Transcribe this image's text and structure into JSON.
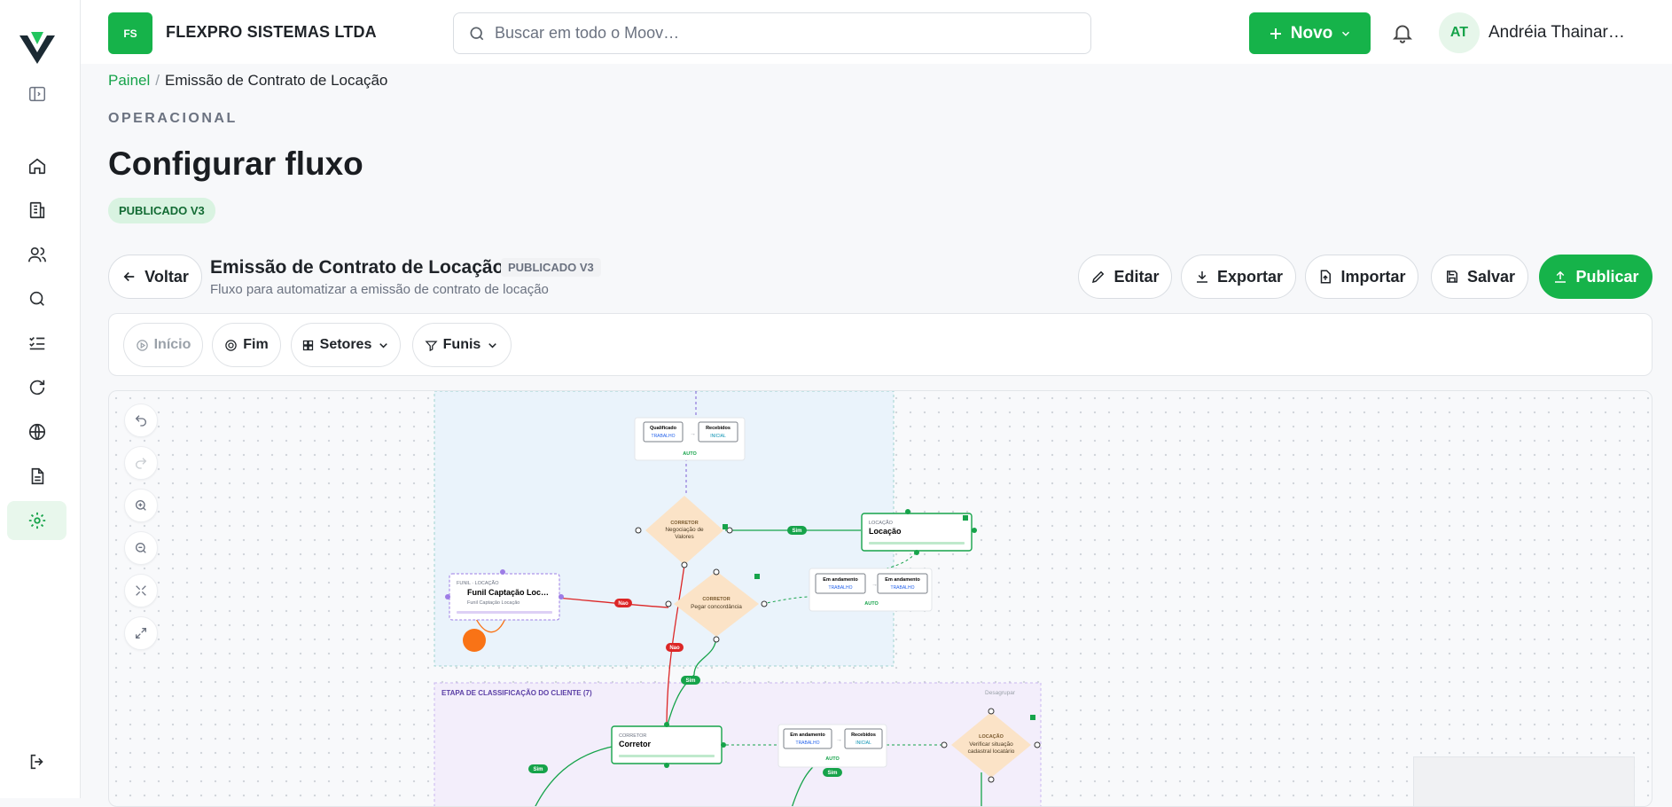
{
  "org": {
    "initials": "FS",
    "name": "FLEXPRO SISTEMAS LTDA"
  },
  "search": {
    "placeholder": "Buscar em todo o Moov…"
  },
  "header": {
    "new_label": "Novo",
    "user_initials": "AT",
    "user_name": "Andréia Thainar…"
  },
  "breadcrumb": {
    "root": "Painel",
    "current": "Emissão de Contrato de Locação"
  },
  "page": {
    "eyebrow": "OPERACIONAL",
    "title": "Configurar fluxo",
    "status": "PUBLICADO V3"
  },
  "flow": {
    "back_label": "Voltar",
    "name": "Emissão de Contrato de Locação",
    "badge": "PUBLICADO V3",
    "description": "Fluxo para automatizar a emissão de contrato de locação",
    "actions": {
      "edit": "Editar",
      "export": "Exportar",
      "import": "Importar",
      "save": "Salvar",
      "publish": "Publicar"
    }
  },
  "filters": {
    "inicio": "Início",
    "fim": "Fim",
    "setores": "Setores",
    "funis": "Funis"
  },
  "diagram": {
    "nodes": {
      "transition_top_from": "Qualificado",
      "transition_top_from_tag": "TRABALHO",
      "transition_top_to": "Recebidos",
      "transition_top_to_tag": "INICIAL",
      "auto": "AUTO",
      "decision1_role": "CORRETOR",
      "decision1_line1": "Negociação de",
      "decision1_line2": "Valores",
      "yes": "Sim",
      "no": "Nao",
      "locacao_role": "LOCAÇÃO",
      "locacao_title": "Locação",
      "transition_mid_from": "Em andamento",
      "transition_mid_from_tag": "TRABALHO",
      "transition_mid_to": "Em andamento",
      "transition_mid_to_tag": "TRABALHO",
      "decision2_role": "CORRETOR",
      "decision2_text": "Pegar concordância",
      "funnel_role": "FUNIL · LOCAÇÃO",
      "funnel_title": "Funil Captação Loc…",
      "funnel_sub": "Funil Captação Locação",
      "group_title": "ETAPA DE CLASSIFICAÇÃO DO CLIENTE (7)",
      "group_action": "Desagrupar",
      "corretor_role": "CORRETOR",
      "corretor_title": "Corretor",
      "transition_low_from": "Em andamento",
      "transition_low_from_tag": "TRABALHO",
      "transition_low_to": "Recebidos",
      "transition_low_to_tag": "INICIAL",
      "decision3_role": "LOCAÇÃO",
      "decision3_line1": "Verificar situação",
      "decision3_line2": "cadastral locatário"
    }
  },
  "colors": {
    "brand": "#16b34a",
    "danger": "#dc2626",
    "decision": "#fbe3c7",
    "group_blue": "#eaf3fb",
    "group_purple": "#f3eefb"
  }
}
